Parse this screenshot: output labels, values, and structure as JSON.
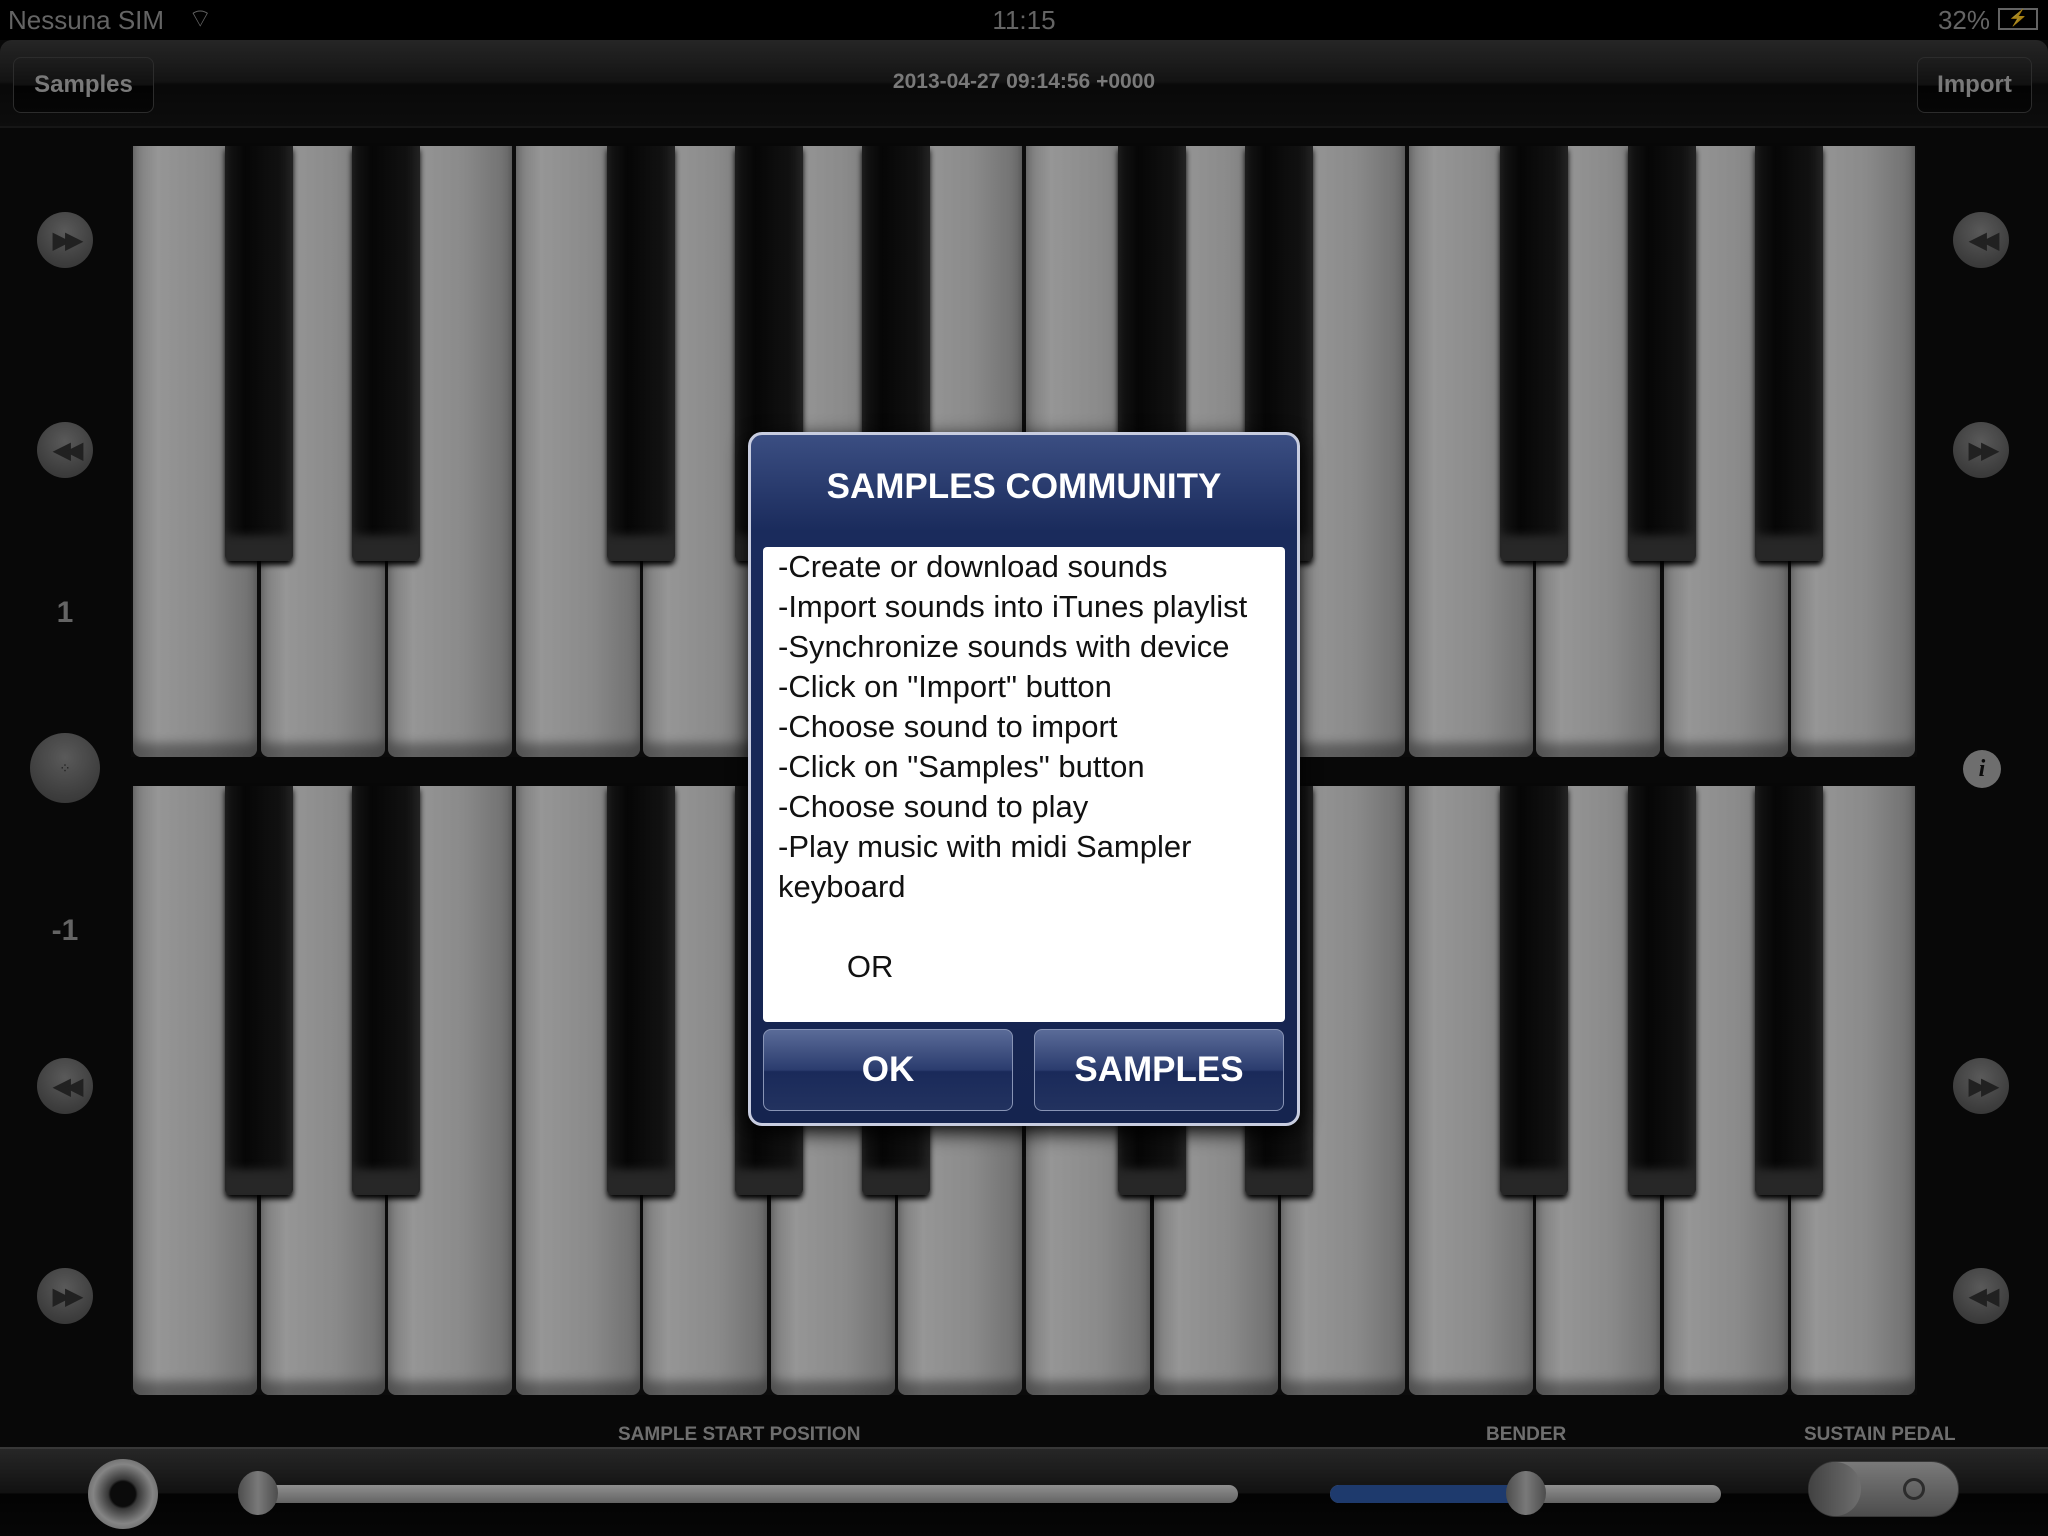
{
  "status_bar": {
    "carrier": "Nessuna SIM",
    "time": "11:15",
    "battery": "32%",
    "icons": [
      "wifi-icon",
      "battery-charging-icon"
    ]
  },
  "toolbar": {
    "left_button": "Samples",
    "title": "2013-04-27 09:14:56 +0000",
    "right_button": "Import"
  },
  "keyboard": {
    "rows": 2,
    "white_keys_per_row": 14
  },
  "left_controls": {
    "upper_octave": "1",
    "lower_octave": "-1",
    "icons": [
      "fast-forward-icon",
      "rewind-icon",
      "midi-connector-icon",
      "rewind-icon",
      "fast-forward-icon"
    ]
  },
  "right_controls": {
    "icons": [
      "rewind-icon",
      "fast-forward-icon",
      "info-icon",
      "fast-forward-icon",
      "rewind-icon"
    ]
  },
  "dialog": {
    "title": "SAMPLES COMMUNITY",
    "text": "-Create or download sounds\n-Import sounds into iTunes playlist\n-Synchronize sounds with device\n-Click on \"Import\" button\n-Choose sound to import\n-Click on \"Samples\" button\n-Choose sound to play\n-Play music with midi Sampler keyboard\n\n        OR",
    "ok": "OK",
    "samples": "SAMPLES"
  },
  "bottom": {
    "sample_start_label": "SAMPLE START POSITION",
    "sample_start_value": 0.0,
    "bender_label": "BENDER",
    "bender_value": 0.5,
    "bender_color": "#2f5aa8",
    "sustain_label": "SUSTAIN PEDAL",
    "sustain_on": false
  }
}
